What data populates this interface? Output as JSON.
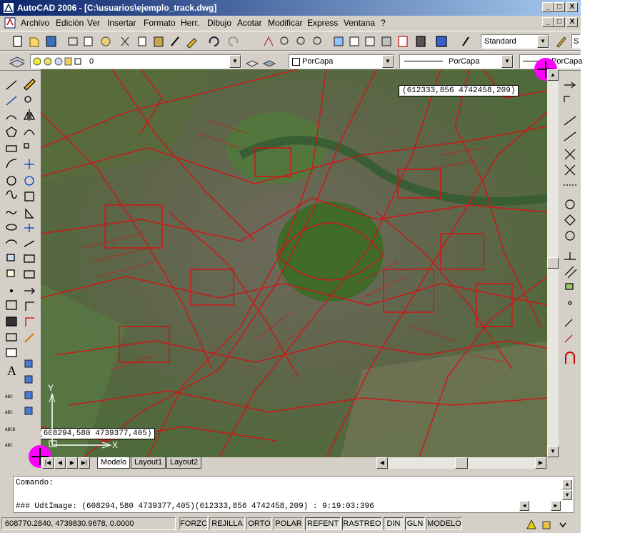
{
  "window": {
    "title": "AutoCAD 2006 - [C:\\usuarios\\ejemplo_track.dwg]",
    "controls": [
      "_",
      "□",
      "X"
    ],
    "mdi_controls": [
      "_",
      "□",
      "X"
    ]
  },
  "menu": {
    "items": [
      "Archivo",
      "Edición",
      "Ver",
      "Insertar",
      "Formato",
      "Herr.",
      "Dibujo",
      "Acotar",
      "Modificar",
      "Express",
      "Ventana",
      "?"
    ]
  },
  "toolbar1": {
    "text_style": "Standard",
    "partial_right": "S"
  },
  "toolbar2": {
    "layer": "0",
    "color": "PorCapa",
    "linetype": "PorCapa",
    "lineweight": "PorCapa"
  },
  "drawing": {
    "coord_top": "(612333,856  4742458,209)",
    "coord_bottom": "(608294,580  4739377,405)",
    "ucs_x": "X",
    "ucs_y": "Y"
  },
  "tabs": [
    "Modelo",
    "Layout1",
    "Layout2"
  ],
  "command": {
    "prompt": "Comando:",
    "history": "### UdtImage: (608294,580  4739377,405)(612333,856  4742458,209) : 9:19:03:396"
  },
  "status": {
    "coords": "608770.2840, 4739830.9678, 0.0000",
    "toggles": [
      "FORZC",
      "REJILLA",
      "ORTO",
      "POLAR",
      "REFENT",
      "RASTREO",
      "DIN",
      "GLN",
      "MODELO"
    ]
  },
  "colors": {
    "title_start": "#0a246a",
    "title_end": "#a6caf0",
    "roads": "#d21414",
    "marker": "#ff00ff",
    "face": "#d4d0c8"
  }
}
